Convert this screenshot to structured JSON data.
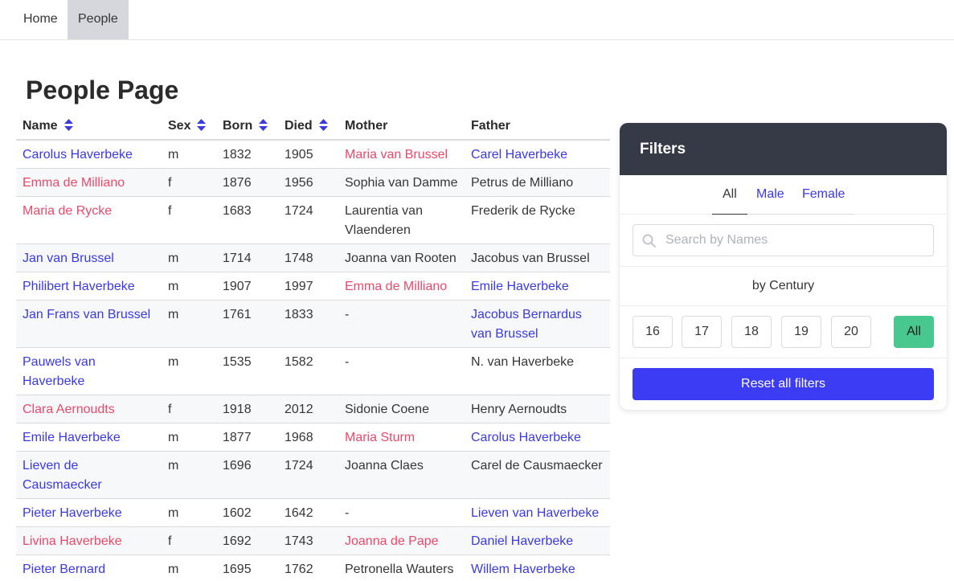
{
  "nav": {
    "items": [
      {
        "label": "Home",
        "active": false
      },
      {
        "label": "People",
        "active": true
      }
    ]
  },
  "page": {
    "title": "People Page"
  },
  "table": {
    "columns": [
      "Name",
      "Sex",
      "Born",
      "Died",
      "Mother",
      "Father"
    ],
    "rows": [
      {
        "name": "Carolus Haverbeke",
        "sex": "m",
        "born": "1832",
        "died": "1905",
        "mother": "Maria van Brussel",
        "father": "Carel Haverbeke"
      },
      {
        "name": "Emma de Milliano",
        "sex": "f",
        "born": "1876",
        "died": "1956",
        "mother": "Sophia van Damme",
        "father": "Petrus de Milliano"
      },
      {
        "name": "Maria de Rycke",
        "sex": "f",
        "born": "1683",
        "died": "1724",
        "mother": "Laurentia van Vlaenderen",
        "father": "Frederik de Rycke"
      },
      {
        "name": "Jan van Brussel",
        "sex": "m",
        "born": "1714",
        "died": "1748",
        "mother": "Joanna van Rooten",
        "father": "Jacobus van Brussel"
      },
      {
        "name": "Philibert Haverbeke",
        "sex": "m",
        "born": "1907",
        "died": "1997",
        "mother": "Emma de Milliano",
        "father": "Emile Haverbeke"
      },
      {
        "name": "Jan Frans van Brussel",
        "sex": "m",
        "born": "1761",
        "died": "1833",
        "mother": "-",
        "father": "Jacobus Bernardus van Brussel"
      },
      {
        "name": "Pauwels van Haverbeke",
        "sex": "m",
        "born": "1535",
        "died": "1582",
        "mother": "-",
        "father": "N. van Haverbeke"
      },
      {
        "name": "Clara Aernoudts",
        "sex": "f",
        "born": "1918",
        "died": "2012",
        "mother": "Sidonie Coene",
        "father": "Henry Aernoudts"
      },
      {
        "name": "Emile Haverbeke",
        "sex": "m",
        "born": "1877",
        "died": "1968",
        "mother": "Maria Sturm",
        "father": "Carolus Haverbeke"
      },
      {
        "name": "Lieven de Causmaecker",
        "sex": "m",
        "born": "1696",
        "died": "1724",
        "mother": "Joanna Claes",
        "father": "Carel de Causmaecker"
      },
      {
        "name": "Pieter Haverbeke",
        "sex": "m",
        "born": "1602",
        "died": "1642",
        "mother": "-",
        "father": "Lieven van Haverbeke"
      },
      {
        "name": "Livina Haverbeke",
        "sex": "f",
        "born": "1692",
        "died": "1743",
        "mother": "Joanna de Pape",
        "father": "Daniel Haverbeke"
      },
      {
        "name": "Pieter Bernard Haverbeke",
        "sex": "m",
        "born": "1695",
        "died": "1762",
        "mother": "Petronella Wauters",
        "father": "Willem Haverbeke"
      }
    ]
  },
  "filters": {
    "title": "Filters",
    "tabs": [
      "All",
      "Male",
      "Female"
    ],
    "active_tab": "All",
    "search_placeholder": "Search by Names",
    "search_value": "",
    "century_label": "by Century",
    "centuries": [
      "16",
      "17",
      "18",
      "19",
      "20",
      "All"
    ],
    "active_century": "All",
    "reset_label": "Reset all filters"
  },
  "colors": {
    "male_link": "#3a3ae0",
    "female_link": "#e94a6a",
    "sort_icon": "#3a3ae0",
    "filters_header": "#363a47",
    "reset_button": "#3c3cf5",
    "active_century": "#48c78e"
  },
  "icons": {
    "sort": "sort-icon",
    "search": "search-icon"
  }
}
